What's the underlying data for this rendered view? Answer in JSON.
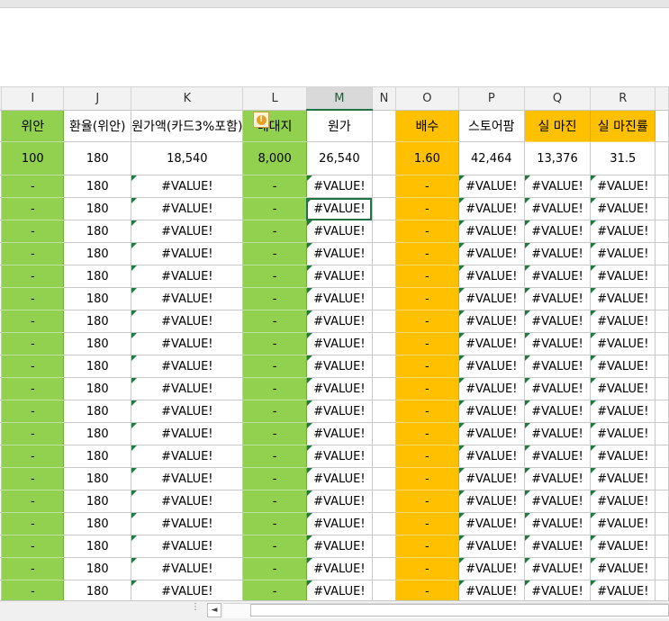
{
  "columns": [
    "I",
    "J",
    "K",
    "L",
    "M",
    "N",
    "O",
    "P",
    "Q",
    "R"
  ],
  "selected_column": "M",
  "header_row": [
    "위안",
    "환율(위안)",
    "원가액(카드3%포함)",
    "배대지",
    "원가",
    "",
    "배수",
    "스토어팜",
    "실 마진",
    "실 마진률"
  ],
  "first_row": [
    "100",
    "180",
    "18,540",
    "8,000",
    "26,540",
    "",
    "1.60",
    "42,464",
    "13,376",
    "31.5"
  ],
  "repeat_row": [
    "-",
    "180",
    "#VALUE!",
    "-",
    "#VALUE!",
    "",
    "-",
    "#VALUE!",
    "#VALUE!",
    "#VALUE!"
  ],
  "repeat_row_count": 19,
  "colors": {
    "green": "#92d050",
    "orange": "#ffc000",
    "excel_green": "#217346"
  },
  "warning_icon": "warning-diamond-icon",
  "scroll_left_icon": "◄"
}
